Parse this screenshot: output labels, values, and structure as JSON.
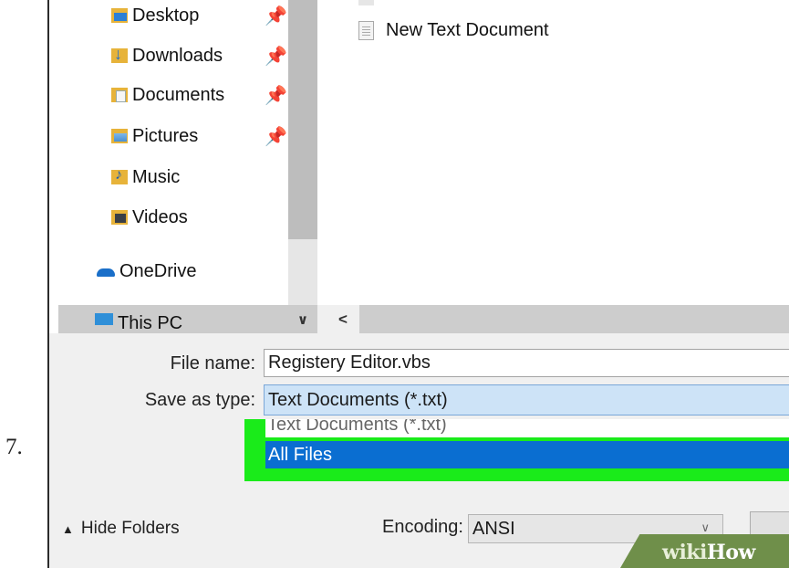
{
  "step": {
    "number": "7."
  },
  "navigation": {
    "items": [
      {
        "label": "Desktop",
        "icon": "desktop-folder-icon",
        "pinned": true
      },
      {
        "label": "Downloads",
        "icon": "downloads-folder-icon",
        "pinned": true
      },
      {
        "label": "Documents",
        "icon": "documents-folder-icon",
        "pinned": true
      },
      {
        "label": "Pictures",
        "icon": "pictures-folder-icon",
        "pinned": true
      },
      {
        "label": "Music",
        "icon": "music-folder-icon",
        "pinned": false
      },
      {
        "label": "Videos",
        "icon": "videos-folder-icon",
        "pinned": false
      },
      {
        "label": "OneDrive",
        "icon": "onedrive-cloud-icon",
        "pinned": false
      },
      {
        "label": "This PC",
        "icon": "this-pc-icon",
        "pinned": false
      }
    ],
    "pin_glyph": "📌",
    "scroll_down_glyph": "∨"
  },
  "files": {
    "items": [
      {
        "name": "New Text Document",
        "icon": "text-document-icon"
      }
    ],
    "scroll_left_glyph": "<"
  },
  "form": {
    "file_name_label": "File name:",
    "file_name_value": "Registery Editor.vbs",
    "save_as_type_label": "Save as type:",
    "save_as_type_value": "Text Documents (*.txt)",
    "dropdown_options": [
      "Text Documents (*.txt)",
      "All Files"
    ],
    "dropdown_selected": "All Files",
    "hide_folders_label": "Hide Folders",
    "hide_folders_glyph": "^",
    "encoding_label": "Encoding:",
    "encoding_value": "ANSI",
    "encoding_chevron": "∨"
  },
  "highlight": {
    "color": "#1aeb1a"
  },
  "colors": {
    "selection": "#0a6ed1",
    "select_field": "#cde3f7"
  },
  "watermark": {
    "part1": "wiki",
    "part2": "How"
  }
}
